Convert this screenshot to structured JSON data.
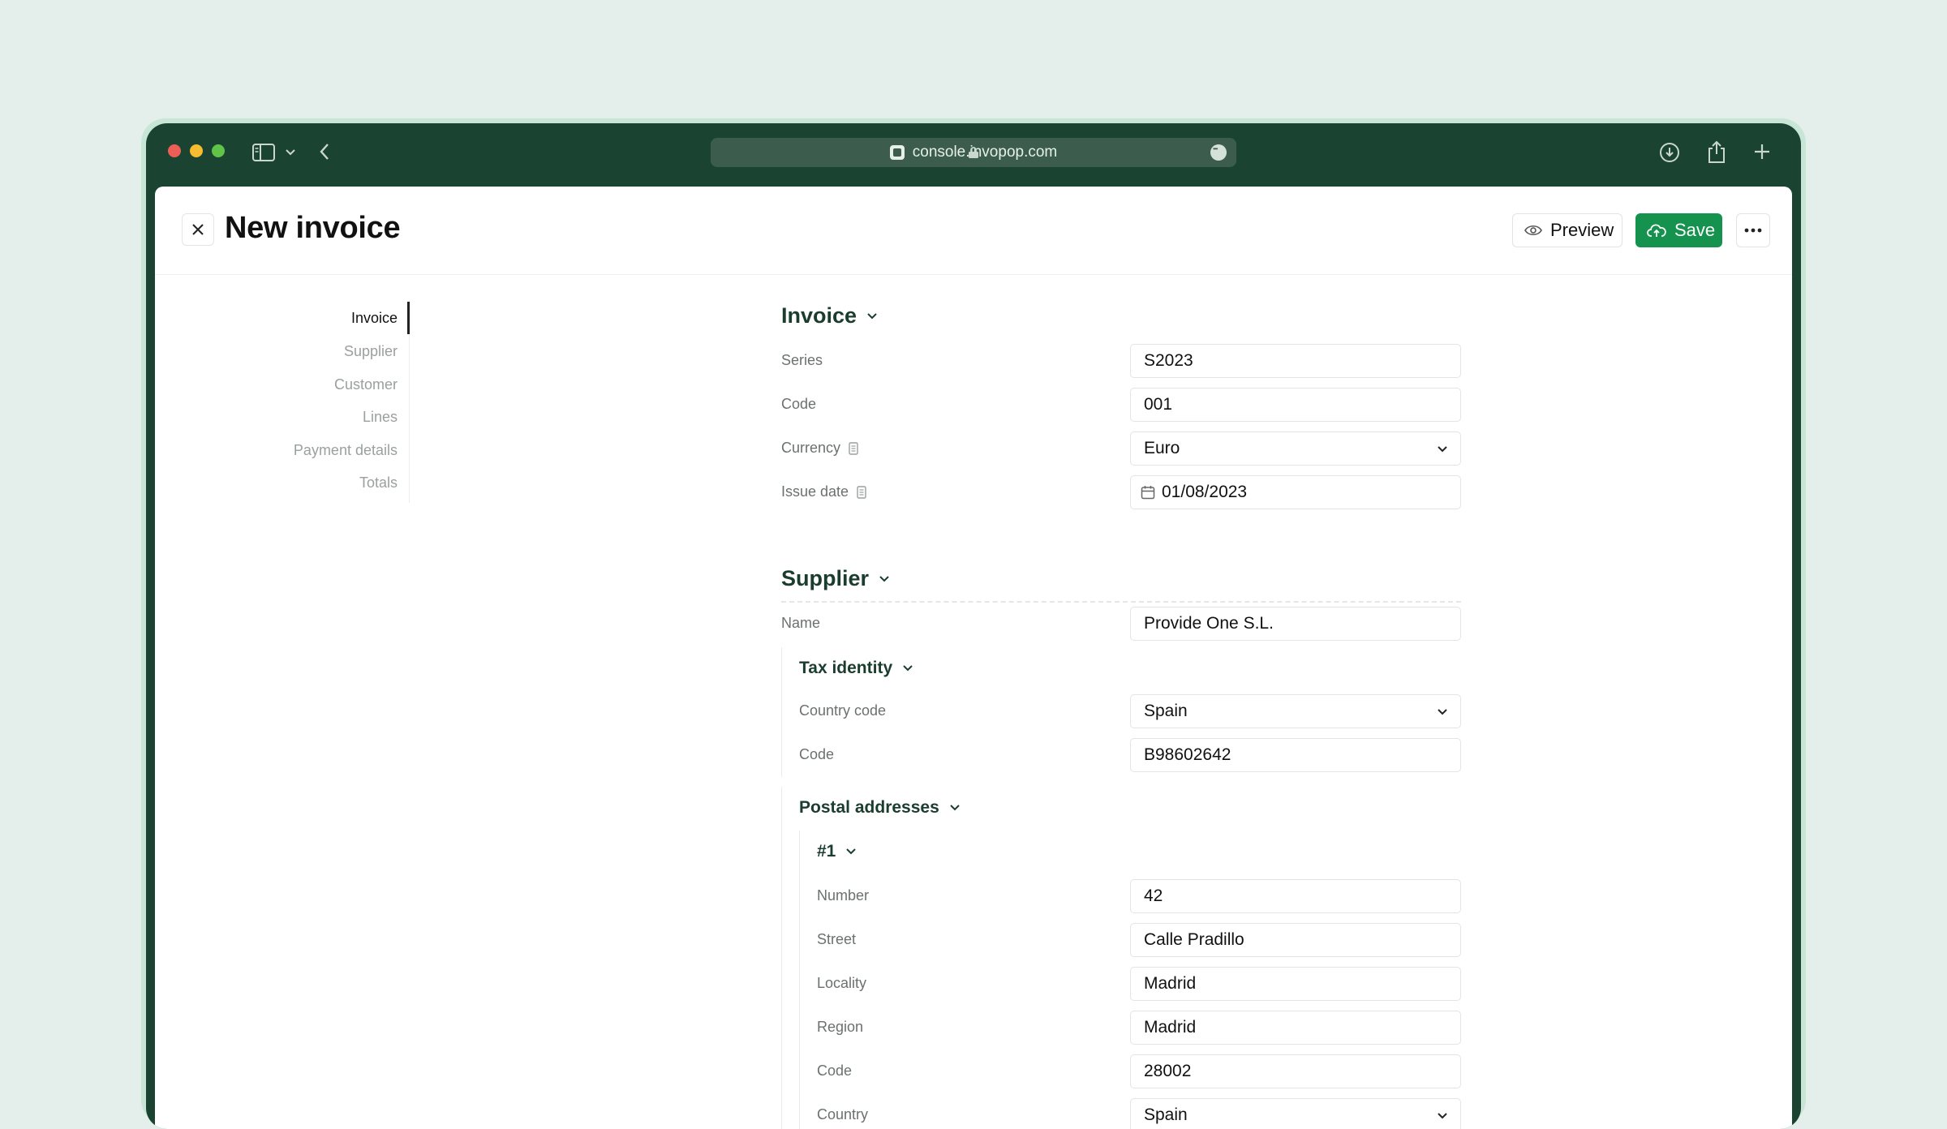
{
  "browser": {
    "url": "console.invopop.com",
    "icons": [
      "sidebar-icon",
      "chevron-down-icon",
      "back-arrow-icon",
      "download-icon",
      "share-icon",
      "plus-icon"
    ]
  },
  "header": {
    "title": "New invoice",
    "preview_label": "Preview",
    "save_label": "Save"
  },
  "colors": {
    "brand_dark": "#1b4332",
    "save_green": "#15924e",
    "background": "#e4eeea"
  },
  "sidenav": {
    "items": [
      {
        "label": "Invoice",
        "active": true
      },
      {
        "label": "Supplier",
        "active": false
      },
      {
        "label": "Customer",
        "active": false
      },
      {
        "label": "Lines",
        "active": false
      },
      {
        "label": "Payment details",
        "active": false
      },
      {
        "label": "Totals",
        "active": false
      }
    ]
  },
  "invoice": {
    "title": "Invoice",
    "series_label": "Series",
    "series_value": "S2023",
    "code_label": "Code",
    "code_value": "001",
    "currency_label": "Currency",
    "currency_value": "Euro",
    "issue_date_label": "Issue date",
    "issue_date_value": "01/08/2023"
  },
  "supplier": {
    "title": "Supplier",
    "name_label": "Name",
    "name_value": "Provide One S.L.",
    "tax_identity": {
      "title": "Tax identity",
      "country_label": "Country code",
      "country_value": "Spain",
      "code_label": "Code",
      "code_value": "B98602642"
    },
    "postal": {
      "title": "Postal addresses",
      "item_title": "#1",
      "number_label": "Number",
      "number_value": "42",
      "street_label": "Street",
      "street_value": "Calle Pradillo",
      "locality_label": "Locality",
      "locality_value": "Madrid",
      "region_label": "Region",
      "region_value": "Madrid",
      "code_label": "Code",
      "code_value": "28002",
      "country_label": "Country",
      "country_value": "Spain"
    }
  }
}
